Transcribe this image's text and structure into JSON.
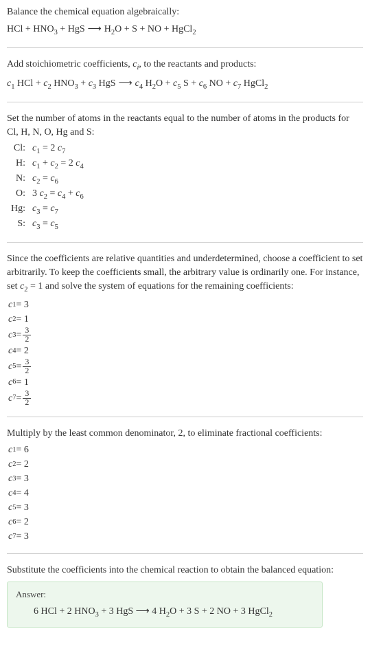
{
  "section1": {
    "line1": "Balance the chemical equation algebraically:",
    "reactants": [
      "HCl",
      "HNO",
      "HgS"
    ],
    "products": [
      "H",
      "O",
      "S",
      "NO",
      "HgCl"
    ],
    "equation_text_parts": {
      "hcl": "HCl",
      "plus": " + ",
      "hno": "HNO",
      "sub3": "3",
      "hgs": "HgS",
      "arrow": "⟶",
      "h": "H",
      "sub2": "2",
      "o": "O",
      "s": "S",
      "no": "NO",
      "hgcl": "HgCl"
    }
  },
  "section2": {
    "line1_a": "Add stoichiometric coefficients, ",
    "line1_ci": "c",
    "line1_i": "i",
    "line1_b": ", to the reactants and products:",
    "c1": "c",
    "n1": "1",
    "c2": "c",
    "n2": "2",
    "c3": "c",
    "n3": "3",
    "c4": "c",
    "n4": "4",
    "c5": "c",
    "n5": "5",
    "c6": "c",
    "n6": "6",
    "c7": "c",
    "n7": "7"
  },
  "section3": {
    "line1": "Set the number of atoms in the reactants equal to the number of atoms in the products for Cl, H, N, O, Hg and S:",
    "atoms": [
      {
        "label": "Cl:",
        "eq_lhs_c": "c",
        "eq_lhs_n": "1",
        "eq_mid": " = 2 ",
        "eq_rhs_c": "c",
        "eq_rhs_n": "7"
      },
      {
        "label": "H:",
        "eq": "c₁ + c₂ = 2 c₄"
      },
      {
        "label": "N:",
        "eq": "c₂ = c₆"
      },
      {
        "label": "O:",
        "eq": "3 c₂ = c₄ + c₆"
      },
      {
        "label": "Hg:",
        "eq": "c₃ = c₇"
      },
      {
        "label": "S:",
        "eq": "c₃ = c₅"
      }
    ],
    "cl_label": "Cl:",
    "h_label": "H:",
    "n_label": "N:",
    "o_label": "O:",
    "hg_label": "Hg:",
    "s_label": "S:"
  },
  "section4": {
    "text": "Since the coefficients are relative quantities and underdetermined, choose a coefficient to set arbitrarily. To keep the coefficients small, the arbitrary value is ordinarily one. For instance, set c₂ = 1 and solve the system of equations for the remaining coefficients:",
    "text_a": "Since the coefficients are relative quantities and underdetermined, choose a coefficient to set arbitrarily. To keep the coefficients small, the arbitrary value is ordinarily one. For instance, set ",
    "text_c2": "c",
    "text_2": "2",
    "text_b": " = 1 and solve the system of equations for the remaining coefficients:",
    "coefs": [
      {
        "c": "c",
        "i": "1",
        "eq": " = 3",
        "frac": false
      },
      {
        "c": "c",
        "i": "2",
        "eq": " = 1",
        "frac": false
      },
      {
        "c": "c",
        "i": "3",
        "eq": " = ",
        "frac": true,
        "num": "3",
        "den": "2"
      },
      {
        "c": "c",
        "i": "4",
        "eq": " = 2",
        "frac": false
      },
      {
        "c": "c",
        "i": "5",
        "eq": " = ",
        "frac": true,
        "num": "3",
        "den": "2"
      },
      {
        "c": "c",
        "i": "6",
        "eq": " = 1",
        "frac": false
      },
      {
        "c": "c",
        "i": "7",
        "eq": " = ",
        "frac": true,
        "num": "3",
        "den": "2"
      }
    ]
  },
  "section5": {
    "text": "Multiply by the least common denominator, 2, to eliminate fractional coefficients:",
    "coefs": [
      {
        "c": "c",
        "i": "1",
        "v": " = 6"
      },
      {
        "c": "c",
        "i": "2",
        "v": " = 2"
      },
      {
        "c": "c",
        "i": "3",
        "v": " = 3"
      },
      {
        "c": "c",
        "i": "4",
        "v": " = 4"
      },
      {
        "c": "c",
        "i": "5",
        "v": " = 3"
      },
      {
        "c": "c",
        "i": "6",
        "v": " = 2"
      },
      {
        "c": "c",
        "i": "7",
        "v": " = 3"
      }
    ]
  },
  "section6": {
    "text": "Substitute the coefficients into the chemical reaction to obtain the balanced equation:",
    "answer_label": "Answer:",
    "final": {
      "p1": "6 HCl + 2 HNO",
      "s3a": "3",
      "p2": " + 3 HgS ",
      "arrow": "⟶",
      "p3": " 4 H",
      "s2a": "2",
      "p4": "O + 3 S + 2 NO + 3 HgCl",
      "s2b": "2"
    }
  },
  "shared": {
    "plus": " + ",
    "space": " ",
    "eq": " = ",
    "arrow": "⟶",
    "sub2": "2",
    "sub3": "3",
    "hcl": "HCl",
    "hno": "HNO",
    "hgs": "HgS",
    "h": "H",
    "o": "O",
    "s": "S",
    "no": "NO",
    "hgcl": "HgCl",
    "two": "2 ",
    "three": "3 ",
    "c": "c",
    "n1": "1",
    "n2": "2",
    "n3": "3",
    "n4": "4",
    "n5": "5",
    "n6": "6",
    "n7": "7"
  }
}
